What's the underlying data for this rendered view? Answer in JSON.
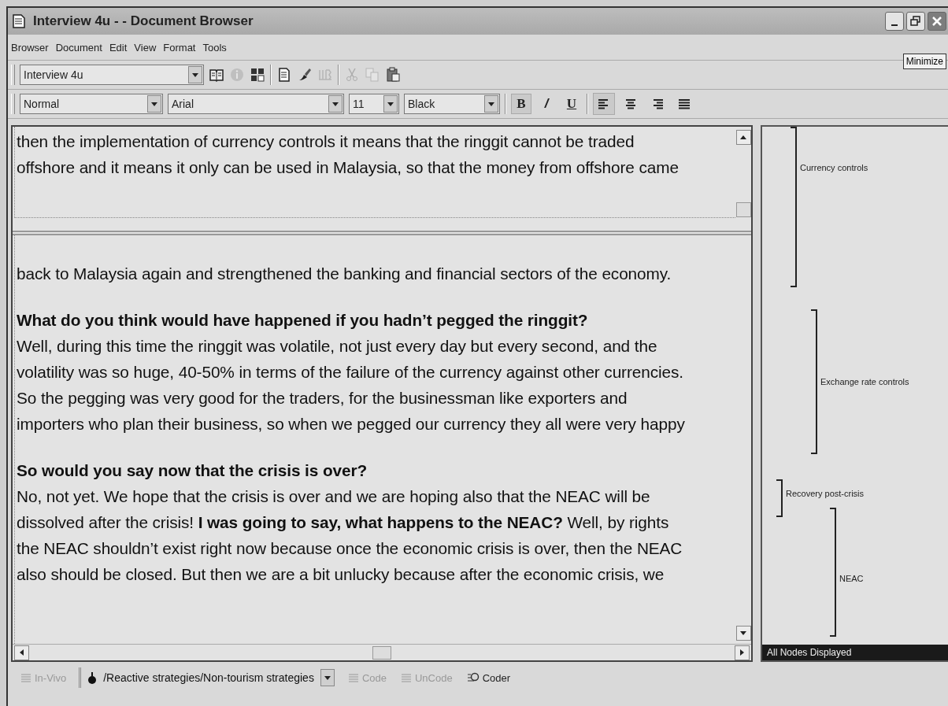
{
  "window": {
    "title": "Interview 4u - - Document Browser",
    "tooltip": "Minimize"
  },
  "menu": [
    "Browser",
    "Document",
    "Edit",
    "View",
    "Format",
    "Tools"
  ],
  "toolbar": {
    "document": "Interview 4u",
    "buttons": [
      {
        "kind": "book",
        "disabled": false
      },
      {
        "kind": "info",
        "disabled": true
      },
      {
        "kind": "grid",
        "disabled": false
      },
      {
        "kind": "sep"
      },
      {
        "kind": "page",
        "disabled": false
      },
      {
        "kind": "brush",
        "disabled": false
      },
      {
        "kind": "iib",
        "disabled": true
      },
      {
        "kind": "sep"
      },
      {
        "kind": "cut",
        "disabled": true
      },
      {
        "kind": "copy",
        "disabled": true
      },
      {
        "kind": "paste",
        "disabled": false
      }
    ]
  },
  "format_bar": {
    "style": "Normal",
    "font": "Arial",
    "size": "11",
    "text_color": "Black",
    "styles": [
      {
        "label": "B",
        "kind": "bold",
        "selected": true
      },
      {
        "label": "/",
        "kind": "italic",
        "selected": false
      },
      {
        "label": "U",
        "kind": "underline",
        "selected": false
      }
    ],
    "align": [
      {
        "kind": "left",
        "selected": true
      },
      {
        "kind": "center",
        "selected": false
      },
      {
        "kind": "right",
        "selected": false
      },
      {
        "kind": "justify",
        "selected": false
      }
    ]
  },
  "document": {
    "top_pane": [
      "then the implementation of currency controls it means that the ringgit cannot be traded",
      "offshore and it means it only can be used in Malaysia, so that the money from offshore came"
    ],
    "paragraphs": [
      {
        "lines": [
          "back to Malaysia again and strengthened the banking and financial sectors of the economy."
        ]
      },
      {
        "lines": [
          "**What do you think would have happened if you hadn’t pegged the ringgit?**",
          "Well, during this time the ringgit was volatile, not just every day but every second, and the",
          "volatility was so huge, 40-50% in terms of the failure of the currency against other currencies.",
          "So the pegging was very good for the traders, for the businessman like exporters and",
          "importers who plan their business, so when we pegged our currency they all were very happy"
        ]
      },
      {
        "lines": [
          "**So would you say now that the crisis is over?**",
          "No, not yet.  We hope that the crisis is over and we are hoping also that the NEAC will be",
          "dissolved after the crisis!  **I was going to say, what happens to the NEAC?**  Well, by rights",
          "the NEAC shouldn’t exist right now because once the economic crisis is over, then the NEAC",
          "also should be closed.  But then we are a bit unlucky because after the economic crisis, we"
        ]
      }
    ]
  },
  "coding_stripes": {
    "stripes": [
      {
        "label": "Currency controls"
      },
      {
        "label": "Exchange rate controls"
      },
      {
        "label": "Recovery post-crisis"
      },
      {
        "label": "NEAC"
      }
    ],
    "status": "All Nodes Displayed"
  },
  "coding_bar": {
    "items": [
      {
        "kind": "button",
        "label": "In-Vivo",
        "disabled": true
      },
      {
        "kind": "node",
        "label": "/Reactive strategies/Non-tourism strategies"
      },
      {
        "kind": "button",
        "label": "Code",
        "disabled": true
      },
      {
        "kind": "button",
        "label": "UnCode",
        "disabled": true
      },
      {
        "kind": "coder",
        "label": "Coder",
        "disabled": false
      }
    ]
  }
}
